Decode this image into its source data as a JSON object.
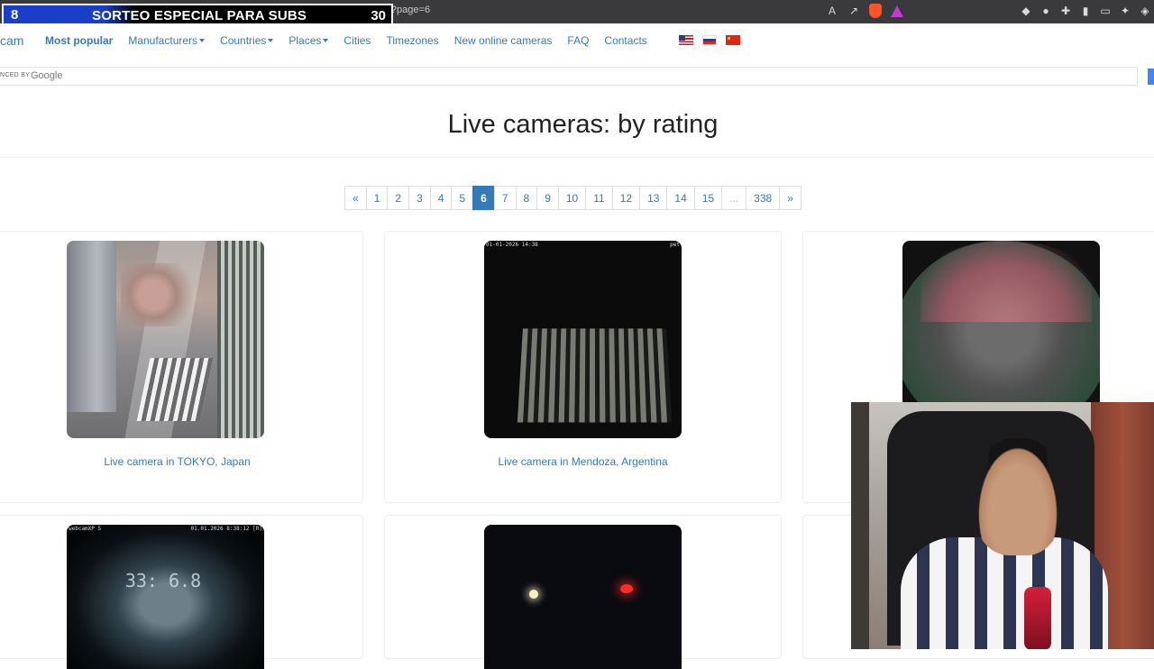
{
  "browser": {
    "url": "No es seguro   insecam.org/en/byrating/?page=6"
  },
  "overlay": {
    "left_number": "8",
    "title": "SORTEO ESPECIAL PARA SUBS",
    "right_number": "30"
  },
  "navbar": {
    "brand": "cam",
    "items": [
      {
        "label": "Most popular",
        "dropdown": false,
        "active": true
      },
      {
        "label": "Manufacturers",
        "dropdown": true
      },
      {
        "label": "Countries",
        "dropdown": true
      },
      {
        "label": "Places",
        "dropdown": true
      },
      {
        "label": "Cities",
        "dropdown": false
      },
      {
        "label": "Timezones",
        "dropdown": false
      },
      {
        "label": "New online cameras",
        "dropdown": false
      },
      {
        "label": "FAQ",
        "dropdown": false
      },
      {
        "label": "Contacts",
        "dropdown": false
      }
    ],
    "flags": [
      "us-flag-icon",
      "russia-flag-icon",
      "china-flag-icon"
    ]
  },
  "search": {
    "powered_by": "NCED BY",
    "provider": "Google"
  },
  "page": {
    "title": "Live cameras: by rating"
  },
  "pagination": {
    "prev": "«",
    "pages": [
      "1",
      "2",
      "3",
      "4",
      "5",
      "6",
      "7",
      "8",
      "9",
      "10",
      "11",
      "12",
      "13",
      "14",
      "15",
      "...",
      "338"
    ],
    "current": "6",
    "next": "»"
  },
  "cameras": [
    {
      "caption": "Live camera in TOKYO, Japan"
    },
    {
      "caption": "Live camera in Mendoza, Argentina",
      "osd_left": "01-01-2026 14:38",
      "osd_right": "pet"
    },
    {
      "caption": ""
    },
    {
      "caption": "",
      "osd_left": "webcamXP 5",
      "osd_right": "01.01.2026 8:38:12 [R]",
      "digits": "33: 6.8"
    },
    {
      "caption": ""
    }
  ],
  "colors": {
    "link": "#337ab7",
    "active_page": "#337ab7",
    "overlay_blue": "#1a3ec8"
  }
}
